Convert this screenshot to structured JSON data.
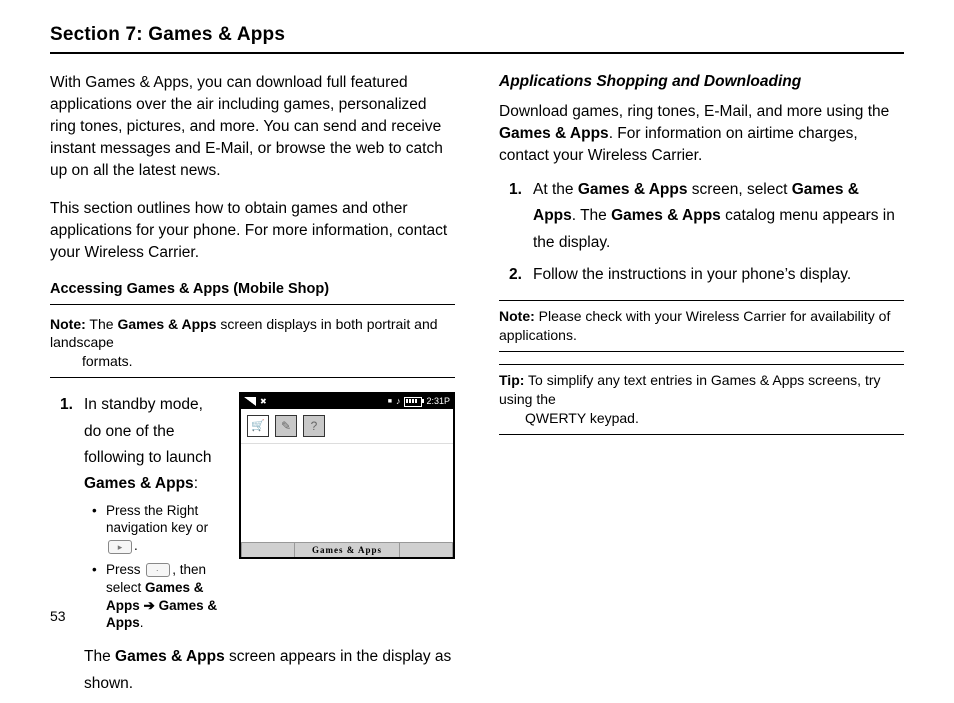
{
  "section_title": "Section 7: Games & Apps",
  "page_number": "53",
  "col_left": {
    "intro_p1": "With Games & Apps, you can download full featured applications over the air including games, personalized ring tones, pictures, and more. You can send and receive instant messages and E-Mail, or browse the web to catch up on all the latest news.",
    "intro_p2": "This section outlines how to obtain games and other applications for your phone. For more information, contact your Wireless Carrier.",
    "h2": "Accessing Games & Apps (Mobile Shop)",
    "note_label": "Note:",
    "note_text": " The Games & Apps screen displays in both portrait and landscape formats.",
    "step1_num": "1.",
    "step1_a": "In standby mode, do one of the following to launch ",
    "step1_b_strong": "Games & Apps",
    "step1_c": ":",
    "bul1_a": "Press the Right navigation key or ",
    "bul1_b": ".",
    "bul2_a": "Press ",
    "bul2_b": ", then select ",
    "bul2_c_strong": "Games & Apps ",
    "bul2_arrow": "➔",
    "bul2_d_strong": " Games & Apps",
    "bul2_e": ".",
    "step1_tail_a": "The ",
    "step1_tail_b_strong": "Games & Apps",
    "step1_tail_c": " screen appears in the display as shown."
  },
  "phone": {
    "status_x": "✖",
    "status_note": "♪",
    "status_rect": "■",
    "status_time": "2:31P",
    "icon_cart": "🛒",
    "icon_pencil": "✎",
    "icon_q": "?",
    "footer_text": "Games   &   Apps"
  },
  "col_right": {
    "h3": "Applications Shopping and Downloading",
    "p_a": "Download games, ring tones, E-Mail, and more using the ",
    "p_b_strong": "Games & Apps",
    "p_c": ". For information on airtime charges, contact your Wireless Carrier.",
    "s1_num": "1.",
    "s1_a": "At the ",
    "s1_b_strong": "Games & Apps",
    "s1_c": " screen, select ",
    "s1_d_strong": "Games & Apps",
    "s1_e": ". The ",
    "s1_f_strong": "Games & Apps",
    "s1_g": " catalog menu appears in the display.",
    "s2_num": "2.",
    "s2_text": "Follow the instructions in your phone’s display.",
    "note_label": "Note:",
    "note_text": " Please check with your Wireless Carrier for availability of applications.",
    "tip_label": "Tip:",
    "tip_a": " To simplify any text entries in Games & Apps screens, try using the",
    "tip_b": "QWERTY keypad."
  }
}
